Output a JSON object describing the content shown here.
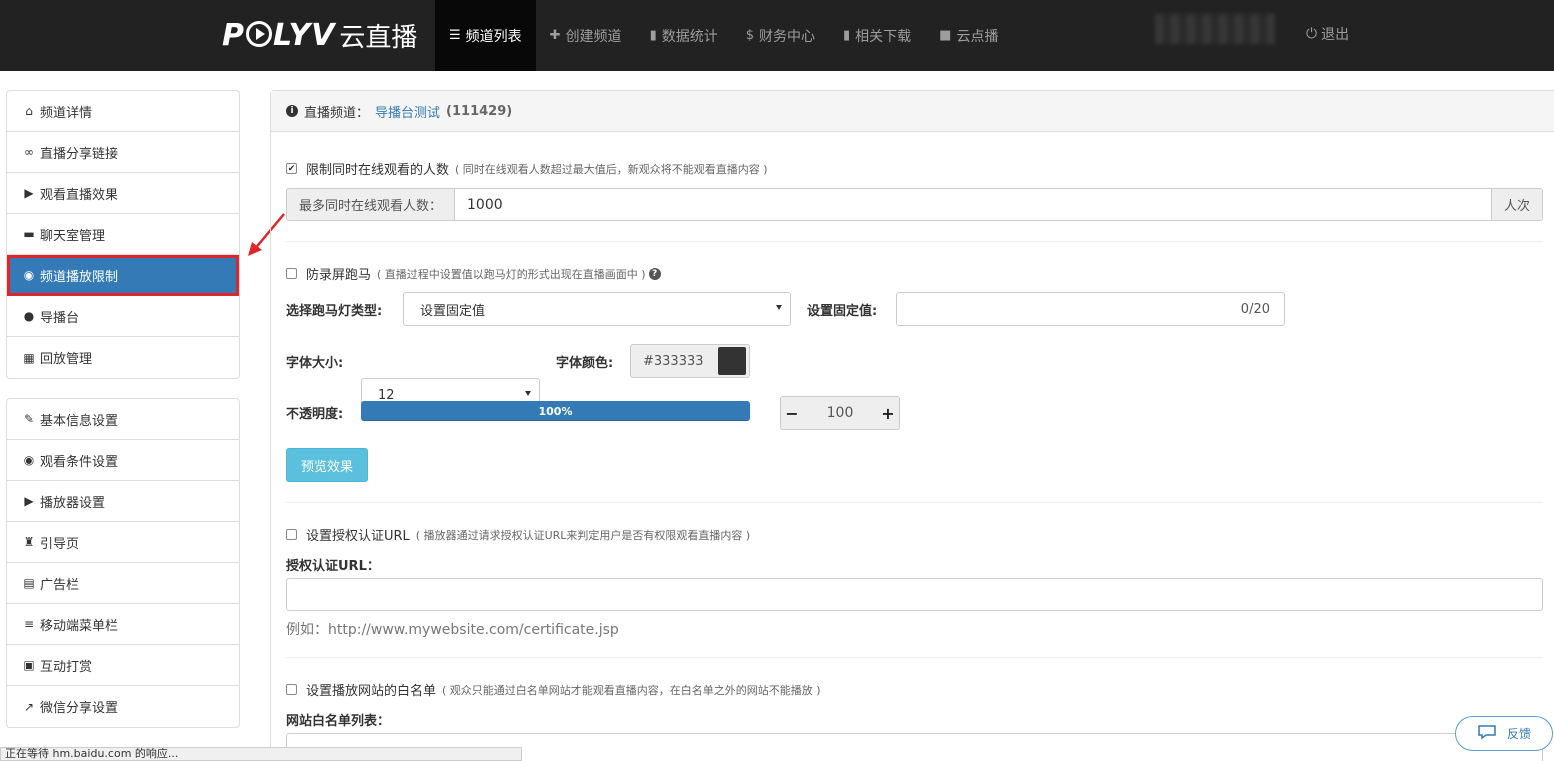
{
  "header": {
    "logo_brand": "POLYV",
    "logo_text": "云直播",
    "nav": [
      {
        "label": "频道列表",
        "icon": "list-icon",
        "glyph": "☰"
      },
      {
        "label": "创建频道",
        "icon": "plus-icon",
        "glyph": "✚"
      },
      {
        "label": "数据统计",
        "icon": "bar-chart-icon",
        "glyph": "▮"
      },
      {
        "label": "财务中心",
        "icon": "dollar-icon",
        "glyph": "$"
      },
      {
        "label": "相关下载",
        "icon": "stats-icon",
        "glyph": "▮"
      },
      {
        "label": "云点播",
        "icon": "video-camera-icon",
        "glyph": "■"
      }
    ],
    "logout_label": "退出"
  },
  "sidebar": {
    "group1": [
      {
        "label": "频道详情",
        "icon": "home-icon",
        "glyph": "⌂"
      },
      {
        "label": "直播分享链接",
        "icon": "link-icon",
        "glyph": "∞"
      },
      {
        "label": "观看直播效果",
        "icon": "play-circle-icon",
        "glyph": "▶"
      },
      {
        "label": "聊天室管理",
        "icon": "comment-icon",
        "glyph": "▬"
      },
      {
        "label": "频道播放限制",
        "icon": "eye-slash-icon",
        "glyph": "◉"
      },
      {
        "label": "导播台",
        "icon": "globe-icon",
        "glyph": "●"
      },
      {
        "label": "回放管理",
        "icon": "film-icon",
        "glyph": "▦"
      }
    ],
    "group2": [
      {
        "label": "基本信息设置",
        "icon": "pencil-icon",
        "glyph": "✎"
      },
      {
        "label": "观看条件设置",
        "icon": "eye-icon",
        "glyph": "◉"
      },
      {
        "label": "播放器设置",
        "icon": "play-square-icon",
        "glyph": "▶"
      },
      {
        "label": "引导页",
        "icon": "tower-icon",
        "glyph": "♜"
      },
      {
        "label": "广告栏",
        "icon": "briefcase-icon",
        "glyph": "▤"
      },
      {
        "label": "移动端菜单栏",
        "icon": "menu-icon",
        "glyph": "≡"
      },
      {
        "label": "互动打赏",
        "icon": "gift-icon",
        "glyph": "▣"
      },
      {
        "label": "微信分享设置",
        "icon": "share-icon",
        "glyph": "↗"
      }
    ]
  },
  "panel": {
    "title_prefix": "直播频道：",
    "channel_name": "导播台测试",
    "channel_id": "(111429)"
  },
  "limit": {
    "label": "限制同时在线观看的人数",
    "hint": "( 同时在线观看人数超过最大值后，新观众将不能观看直播内容 )",
    "max_label": "最多同时在线观看人数：",
    "max_value": "1000",
    "unit": "人次"
  },
  "marquee": {
    "label": "防录屏跑马",
    "hint": "( 直播过程中设置值以跑马灯的形式出现在直播画面中 )",
    "type_label": "选择跑马灯类型:",
    "type_value": "设置固定值",
    "fixed_label": "设置固定值:",
    "fixed_counter": "0/20",
    "font_size_label": "字体大小:",
    "font_size_value": "12",
    "font_color_label": "字体颜色:",
    "font_color_value": "#333333",
    "opacity_label": "不透明度:",
    "opacity_text": "100%",
    "opacity_fraction": 1.0,
    "opacity_step_value": "100",
    "preview_button": "预览效果"
  },
  "auth": {
    "label": "设置授权认证URL",
    "hint": "( 播放器通过请求授权认证URL来判定用户是否有权限观看直播内容 )",
    "url_label": "授权认证URL：",
    "example": "例如：http://www.mywebsite.com/certificate.jsp"
  },
  "whitelist": {
    "label": "设置播放网站的白名单",
    "hint": "( 观众只能通过白名单网站才能观看直播内容，在白名单之外的网站不能播放 )",
    "list_label": "网站白名单列表："
  },
  "status_bar": "正在等待 hm.baidu.com 的响应...",
  "feedback_label": "反馈",
  "colors": {
    "accent": "#337ab7",
    "highlight_border": "#e0262b",
    "info_button": "#5bc0de",
    "topbar": "#222222",
    "swatch": "#333333"
  }
}
